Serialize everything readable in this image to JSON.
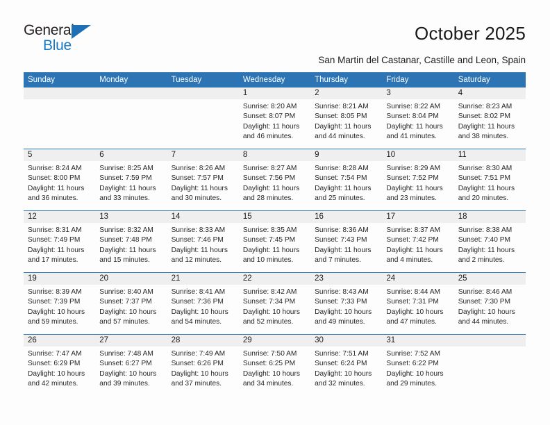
{
  "brand": {
    "name_dark": "General",
    "name_blue": "Blue",
    "accent_color": "#2d74b5",
    "logo_blue": "#1878c4"
  },
  "header": {
    "title": "October 2025",
    "subtitle": "San Martin del Castanar, Castille and Leon, Spain"
  },
  "calendar": {
    "weekdays": [
      "Sunday",
      "Monday",
      "Tuesday",
      "Wednesday",
      "Thursday",
      "Friday",
      "Saturday"
    ],
    "header_bg": "#2d74b5",
    "daynum_bg": "#efefef",
    "weeks": [
      [
        {
          "day": "",
          "empty": true,
          "sunrise": "",
          "sunset": "",
          "daylight_1": "",
          "daylight_2": ""
        },
        {
          "day": "",
          "empty": true,
          "sunrise": "",
          "sunset": "",
          "daylight_1": "",
          "daylight_2": ""
        },
        {
          "day": "",
          "empty": true,
          "sunrise": "",
          "sunset": "",
          "daylight_1": "",
          "daylight_2": ""
        },
        {
          "day": "1",
          "sunrise": "Sunrise: 8:20 AM",
          "sunset": "Sunset: 8:07 PM",
          "daylight_1": "Daylight: 11 hours",
          "daylight_2": "and 46 minutes."
        },
        {
          "day": "2",
          "sunrise": "Sunrise: 8:21 AM",
          "sunset": "Sunset: 8:05 PM",
          "daylight_1": "Daylight: 11 hours",
          "daylight_2": "and 44 minutes."
        },
        {
          "day": "3",
          "sunrise": "Sunrise: 8:22 AM",
          "sunset": "Sunset: 8:04 PM",
          "daylight_1": "Daylight: 11 hours",
          "daylight_2": "and 41 minutes."
        },
        {
          "day": "4",
          "sunrise": "Sunrise: 8:23 AM",
          "sunset": "Sunset: 8:02 PM",
          "daylight_1": "Daylight: 11 hours",
          "daylight_2": "and 38 minutes."
        }
      ],
      [
        {
          "day": "5",
          "sunrise": "Sunrise: 8:24 AM",
          "sunset": "Sunset: 8:00 PM",
          "daylight_1": "Daylight: 11 hours",
          "daylight_2": "and 36 minutes."
        },
        {
          "day": "6",
          "sunrise": "Sunrise: 8:25 AM",
          "sunset": "Sunset: 7:59 PM",
          "daylight_1": "Daylight: 11 hours",
          "daylight_2": "and 33 minutes."
        },
        {
          "day": "7",
          "sunrise": "Sunrise: 8:26 AM",
          "sunset": "Sunset: 7:57 PM",
          "daylight_1": "Daylight: 11 hours",
          "daylight_2": "and 30 minutes."
        },
        {
          "day": "8",
          "sunrise": "Sunrise: 8:27 AM",
          "sunset": "Sunset: 7:56 PM",
          "daylight_1": "Daylight: 11 hours",
          "daylight_2": "and 28 minutes."
        },
        {
          "day": "9",
          "sunrise": "Sunrise: 8:28 AM",
          "sunset": "Sunset: 7:54 PM",
          "daylight_1": "Daylight: 11 hours",
          "daylight_2": "and 25 minutes."
        },
        {
          "day": "10",
          "sunrise": "Sunrise: 8:29 AM",
          "sunset": "Sunset: 7:52 PM",
          "daylight_1": "Daylight: 11 hours",
          "daylight_2": "and 23 minutes."
        },
        {
          "day": "11",
          "sunrise": "Sunrise: 8:30 AM",
          "sunset": "Sunset: 7:51 PM",
          "daylight_1": "Daylight: 11 hours",
          "daylight_2": "and 20 minutes."
        }
      ],
      [
        {
          "day": "12",
          "sunrise": "Sunrise: 8:31 AM",
          "sunset": "Sunset: 7:49 PM",
          "daylight_1": "Daylight: 11 hours",
          "daylight_2": "and 17 minutes."
        },
        {
          "day": "13",
          "sunrise": "Sunrise: 8:32 AM",
          "sunset": "Sunset: 7:48 PM",
          "daylight_1": "Daylight: 11 hours",
          "daylight_2": "and 15 minutes."
        },
        {
          "day": "14",
          "sunrise": "Sunrise: 8:33 AM",
          "sunset": "Sunset: 7:46 PM",
          "daylight_1": "Daylight: 11 hours",
          "daylight_2": "and 12 minutes."
        },
        {
          "day": "15",
          "sunrise": "Sunrise: 8:35 AM",
          "sunset": "Sunset: 7:45 PM",
          "daylight_1": "Daylight: 11 hours",
          "daylight_2": "and 10 minutes."
        },
        {
          "day": "16",
          "sunrise": "Sunrise: 8:36 AM",
          "sunset": "Sunset: 7:43 PM",
          "daylight_1": "Daylight: 11 hours",
          "daylight_2": "and 7 minutes."
        },
        {
          "day": "17",
          "sunrise": "Sunrise: 8:37 AM",
          "sunset": "Sunset: 7:42 PM",
          "daylight_1": "Daylight: 11 hours",
          "daylight_2": "and 4 minutes."
        },
        {
          "day": "18",
          "sunrise": "Sunrise: 8:38 AM",
          "sunset": "Sunset: 7:40 PM",
          "daylight_1": "Daylight: 11 hours",
          "daylight_2": "and 2 minutes."
        }
      ],
      [
        {
          "day": "19",
          "sunrise": "Sunrise: 8:39 AM",
          "sunset": "Sunset: 7:39 PM",
          "daylight_1": "Daylight: 10 hours",
          "daylight_2": "and 59 minutes."
        },
        {
          "day": "20",
          "sunrise": "Sunrise: 8:40 AM",
          "sunset": "Sunset: 7:37 PM",
          "daylight_1": "Daylight: 10 hours",
          "daylight_2": "and 57 minutes."
        },
        {
          "day": "21",
          "sunrise": "Sunrise: 8:41 AM",
          "sunset": "Sunset: 7:36 PM",
          "daylight_1": "Daylight: 10 hours",
          "daylight_2": "and 54 minutes."
        },
        {
          "day": "22",
          "sunrise": "Sunrise: 8:42 AM",
          "sunset": "Sunset: 7:34 PM",
          "daylight_1": "Daylight: 10 hours",
          "daylight_2": "and 52 minutes."
        },
        {
          "day": "23",
          "sunrise": "Sunrise: 8:43 AM",
          "sunset": "Sunset: 7:33 PM",
          "daylight_1": "Daylight: 10 hours",
          "daylight_2": "and 49 minutes."
        },
        {
          "day": "24",
          "sunrise": "Sunrise: 8:44 AM",
          "sunset": "Sunset: 7:31 PM",
          "daylight_1": "Daylight: 10 hours",
          "daylight_2": "and 47 minutes."
        },
        {
          "day": "25",
          "sunrise": "Sunrise: 8:46 AM",
          "sunset": "Sunset: 7:30 PM",
          "daylight_1": "Daylight: 10 hours",
          "daylight_2": "and 44 minutes."
        }
      ],
      [
        {
          "day": "26",
          "sunrise": "Sunrise: 7:47 AM",
          "sunset": "Sunset: 6:29 PM",
          "daylight_1": "Daylight: 10 hours",
          "daylight_2": "and 42 minutes."
        },
        {
          "day": "27",
          "sunrise": "Sunrise: 7:48 AM",
          "sunset": "Sunset: 6:27 PM",
          "daylight_1": "Daylight: 10 hours",
          "daylight_2": "and 39 minutes."
        },
        {
          "day": "28",
          "sunrise": "Sunrise: 7:49 AM",
          "sunset": "Sunset: 6:26 PM",
          "daylight_1": "Daylight: 10 hours",
          "daylight_2": "and 37 minutes."
        },
        {
          "day": "29",
          "sunrise": "Sunrise: 7:50 AM",
          "sunset": "Sunset: 6:25 PM",
          "daylight_1": "Daylight: 10 hours",
          "daylight_2": "and 34 minutes."
        },
        {
          "day": "30",
          "sunrise": "Sunrise: 7:51 AM",
          "sunset": "Sunset: 6:24 PM",
          "daylight_1": "Daylight: 10 hours",
          "daylight_2": "and 32 minutes."
        },
        {
          "day": "31",
          "sunrise": "Sunrise: 7:52 AM",
          "sunset": "Sunset: 6:22 PM",
          "daylight_1": "Daylight: 10 hours",
          "daylight_2": "and 29 minutes."
        },
        {
          "day": "",
          "empty": true,
          "sunrise": "",
          "sunset": "",
          "daylight_1": "",
          "daylight_2": ""
        }
      ]
    ]
  }
}
